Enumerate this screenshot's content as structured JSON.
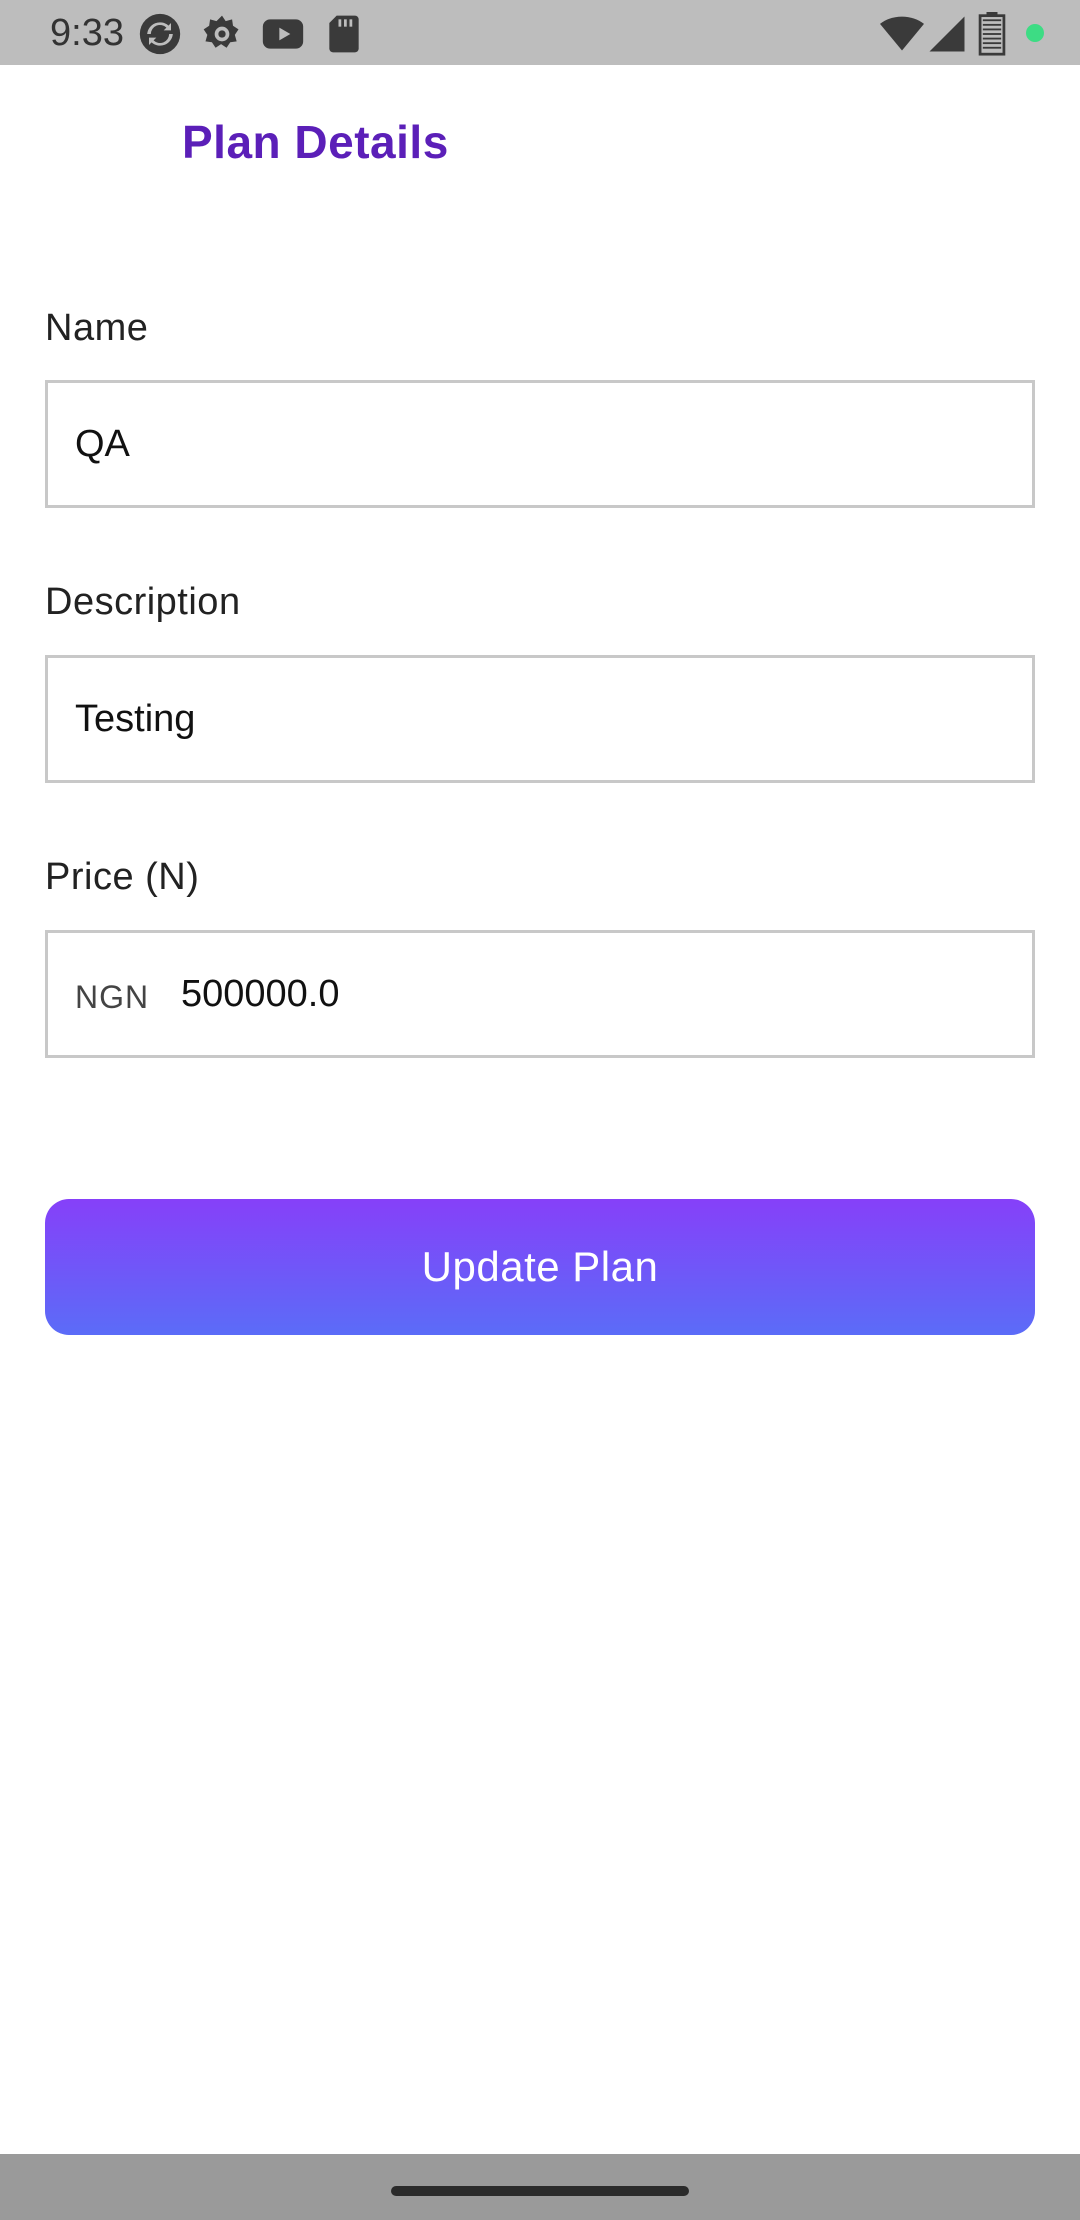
{
  "status_bar": {
    "time": "9:33",
    "icons": [
      "sync-icon",
      "settings-icon",
      "youtube-icon",
      "sd-card-icon",
      "wifi-icon",
      "cell-signal-icon",
      "battery-icon",
      "dot-indicator-icon"
    ],
    "indicator_color": "#3ddc84"
  },
  "header": {
    "title": "Plan Details",
    "title_color": "#5b1fb8"
  },
  "form": {
    "name": {
      "label": "Name",
      "value": "QA"
    },
    "description": {
      "label": "Description",
      "value": "Testing"
    },
    "price": {
      "label": "Price (N)",
      "prefix": "NGN",
      "value": "500000.0"
    }
  },
  "actions": {
    "update_label": "Update Plan",
    "gradient_start": "#8640f9",
    "gradient_end": "#5b6cf8"
  }
}
